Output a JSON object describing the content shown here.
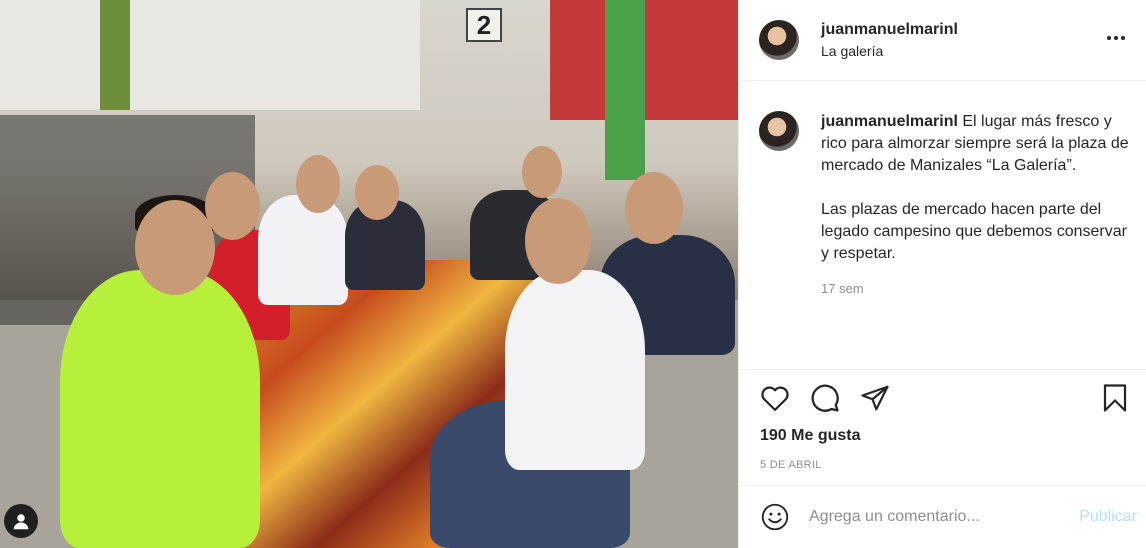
{
  "post": {
    "username": "juanmanuelmarinl",
    "location": "La galería",
    "photo_sign_number": "2",
    "caption_paragraph_1": "El lugar más fresco y rico para almorzar siempre será la plaza de mercado de Manizales “La Galería”.",
    "caption_paragraph_2": "Las plazas de mercado hacen parte del legado campesino que debemos conservar y respetar.",
    "time_ago": "17 sem",
    "likes": "190 Me gusta",
    "date": "5 DE ABRIL"
  },
  "comment": {
    "placeholder": "Agrega un comentario...",
    "publish_label": "Publicar"
  },
  "icons": {
    "more": "more-options-icon",
    "like": "heart-icon",
    "comment": "comment-icon",
    "share": "share-icon",
    "save": "bookmark-icon",
    "emoji": "emoji-icon",
    "tagged": "user-tag-icon"
  },
  "colors": {
    "publish_disabled": "#b2dffc",
    "secondary_text": "#8e8e8e",
    "border": "#efefef"
  }
}
